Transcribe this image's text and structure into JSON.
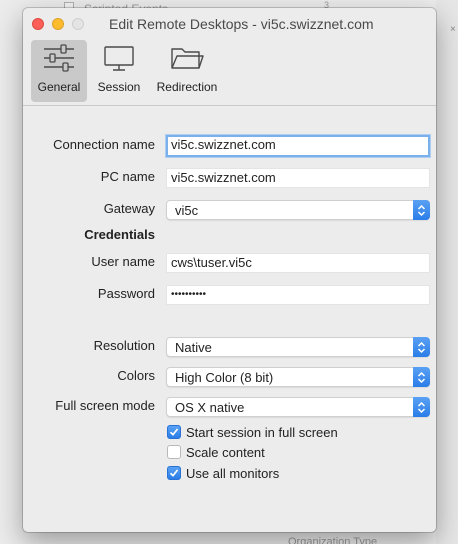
{
  "background": {
    "top_text": "Scripted Events",
    "top_number": "3",
    "bottom_text": "Organization Type",
    "right_mark": "×"
  },
  "dialog": {
    "title": "Edit Remote Desktops - vi5c.swizznet.com"
  },
  "toolbar": {
    "items": [
      {
        "label": "General",
        "icon": "sliders-icon",
        "selected": true
      },
      {
        "label": "Session",
        "icon": "monitor-icon",
        "selected": false
      },
      {
        "label": "Redirection",
        "icon": "folder-icon",
        "selected": false
      }
    ]
  },
  "form": {
    "connection_name_label": "Connection name",
    "connection_name_value": "vi5c.swizznet.com",
    "pc_name_label": "PC name",
    "pc_name_value": "vi5c.swizznet.com",
    "gateway_label": "Gateway",
    "gateway_value": "vi5c",
    "credentials_heading": "Credentials",
    "user_name_label": "User name",
    "user_name_value": "cws\\tuser.vi5c",
    "password_label": "Password",
    "password_value": "••••••••••",
    "resolution_label": "Resolution",
    "resolution_value": "Native",
    "colors_label": "Colors",
    "colors_value": "High Color (8 bit)",
    "fullscreen_label": "Full screen mode",
    "fullscreen_value": "OS X native",
    "checkboxes": [
      {
        "label": "Start session in full screen",
        "checked": true
      },
      {
        "label": "Scale content",
        "checked": false
      },
      {
        "label": "Use all monitors",
        "checked": true
      }
    ]
  },
  "colors": {
    "accent": "#2a7de8",
    "close": "#fc5f57",
    "minimize": "#fdbc2e",
    "focus_ring": "#7ab1ea"
  }
}
